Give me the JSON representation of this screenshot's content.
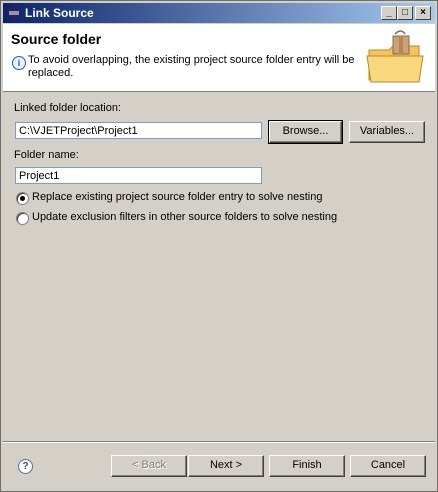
{
  "window": {
    "title": "Link Source"
  },
  "titlebar_buttons": {
    "minimize": "_",
    "maximize": "□",
    "close": "×"
  },
  "banner": {
    "heading": "Source folder",
    "message": "To avoid overlapping, the existing project source folder entry will be replaced.",
    "info_icon": "info-icon",
    "image_icon": "folder-icon"
  },
  "form": {
    "location_label": "Linked folder location:",
    "location_value": "C:\\VJETProject\\Project1",
    "browse_label": "Browse...",
    "variables_label": "Variables...",
    "folder_name_label": "Folder name:",
    "folder_name_value": "Project1",
    "options": [
      {
        "label": "Replace existing project source folder entry to solve nesting",
        "selected": true
      },
      {
        "label": "Update exclusion filters in other source folders to solve nesting",
        "selected": false
      }
    ]
  },
  "footer": {
    "help_icon": "?",
    "back_label": "< Back",
    "next_label": "Next >",
    "finish_label": "Finish",
    "cancel_label": "Cancel"
  }
}
